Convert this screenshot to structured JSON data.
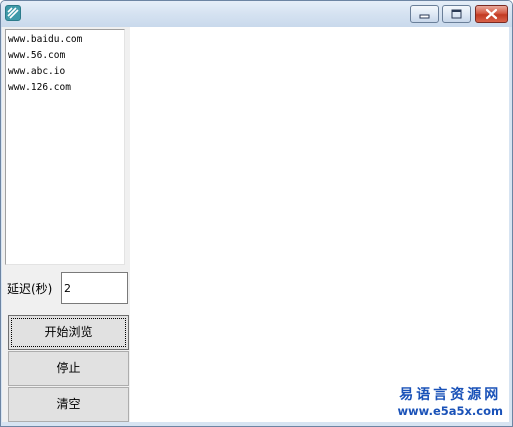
{
  "window": {
    "title": "",
    "icon": "app-icon",
    "controls": {
      "minimize": "minimize-icon",
      "maximize": "maximize-icon",
      "close": "close-icon"
    }
  },
  "url_list": {
    "items": [
      "www.baidu.com",
      "www.56.com",
      "www.abc.io",
      "www.126.com"
    ]
  },
  "delay": {
    "label": "延迟(秒)",
    "value": "2"
  },
  "buttons": {
    "start": "开始浏览",
    "stop": "停止",
    "clear": "清空"
  },
  "watermark": {
    "title": "易语言资源网",
    "url": "www.e5a5x.com"
  },
  "colors": {
    "watermark": "#1a52b8",
    "close_button": "#c23a22"
  }
}
